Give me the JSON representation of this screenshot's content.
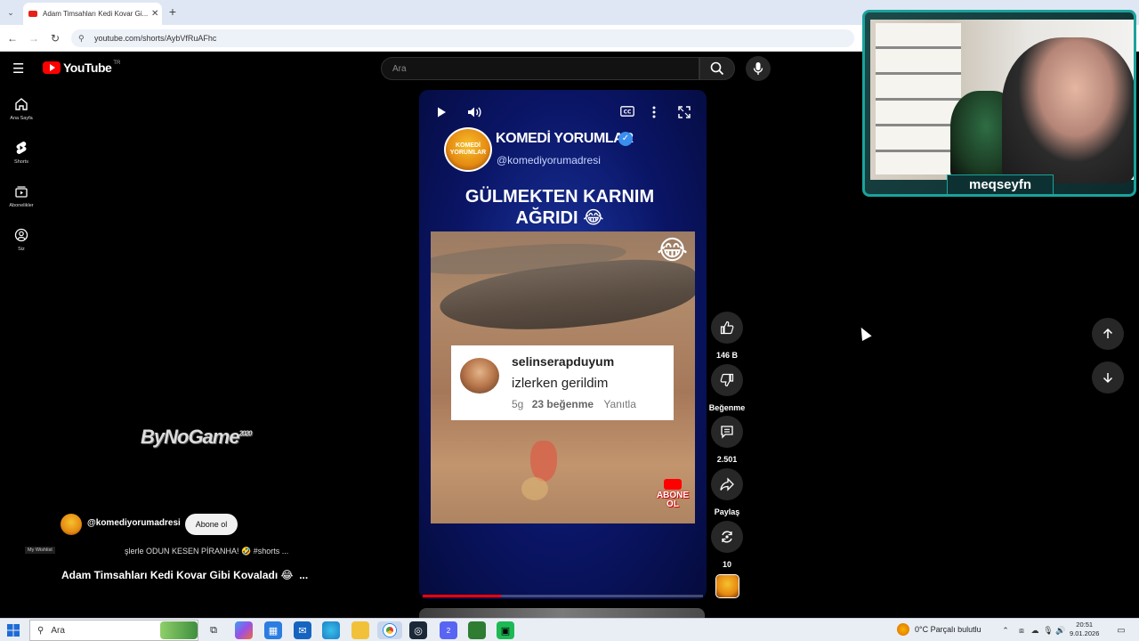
{
  "browser": {
    "tab_title": "Adam Timsahları Kedi Kovar Gi...",
    "url": "youtube.com/shorts/AybVfRuAFhc"
  },
  "header": {
    "logo": "YouTube",
    "country_code": "TR",
    "search_placeholder": "Ara"
  },
  "sidebar": {
    "items": [
      {
        "label": "Ana Sayfa",
        "icon": "home-icon"
      },
      {
        "label": "Shorts",
        "icon": "shorts-icon"
      },
      {
        "label": "Abonelikler",
        "icon": "subscriptions-icon"
      },
      {
        "label": "Siz",
        "icon": "you-icon"
      }
    ]
  },
  "video": {
    "overlay": {
      "channel_name": "KOMEDİ YORUMLAR",
      "channel_handle": "@komediyorumadresi",
      "avatar_text": "KOMEDİ YORUMLAR",
      "headline": "GÜLMEKTEN KARNIM AĞRIDI 😂",
      "emoji": "😂",
      "comment": {
        "user": "selinserapduyum",
        "text": "izlerken gerildim",
        "age": "5g",
        "likes": "23 beğenme",
        "reply": "Yanıtla"
      },
      "abone_sticker": "ABONE OL"
    },
    "progress_fraction": 0.28
  },
  "actions": {
    "like_count": "146 B",
    "dislike_label": "Beğenme",
    "comment_count": "2.501",
    "share_label": "Paylaş",
    "remix_count": "10"
  },
  "info": {
    "brand_watermark": "ByNoGame",
    "brand_sup": "2020",
    "channel_handle": "@komediyorumadresi",
    "subscribe_label": "Abone ol",
    "wishlist_tooltip": "My Wishlist",
    "playlist_line": "şlerle ODUN KESEN PİRANHA! 🤣  #shorts ...",
    "video_title": "Adam Timsahları Kedi Kovar Gibi Kovaladı 😂",
    "more": "..."
  },
  "webcam": {
    "streamer": "meqseyfn"
  },
  "taskbar": {
    "search_placeholder": "Ara",
    "weather": "0°C  Parçalı bulutlu",
    "time": "20:51",
    "date": "9.01.2026",
    "badge": "2"
  }
}
